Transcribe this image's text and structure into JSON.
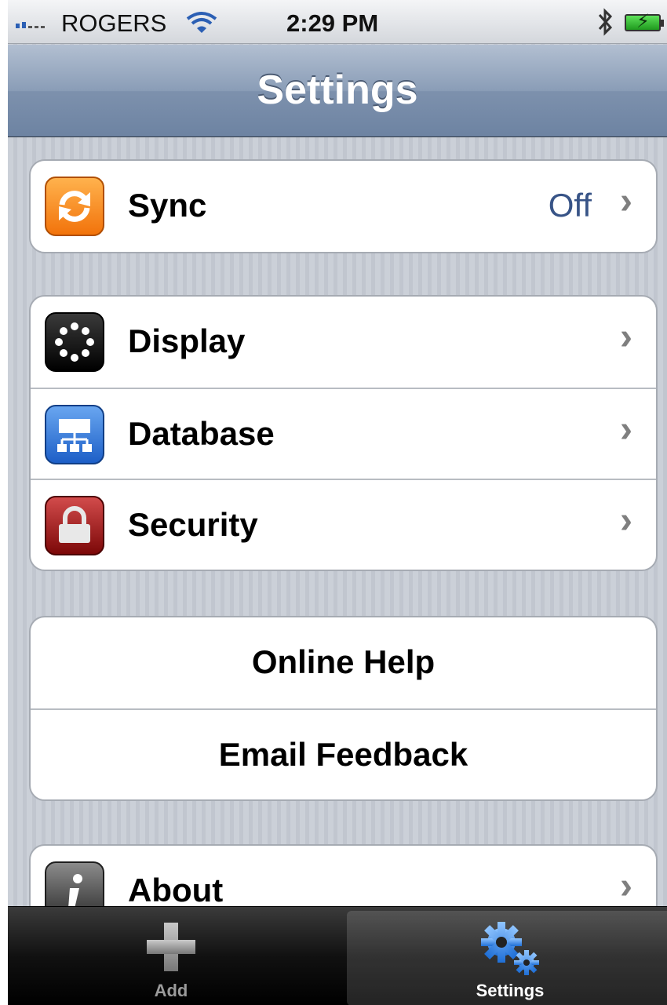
{
  "status_bar": {
    "carrier": "ROGERS",
    "time": "2:29 PM"
  },
  "nav": {
    "title": "Settings"
  },
  "groups": {
    "sync": {
      "label": "Sync",
      "value": "Off",
      "icon": "sync-icon"
    },
    "config": [
      {
        "label": "Display",
        "icon": "display-icon"
      },
      {
        "label": "Database",
        "icon": "database-icon"
      },
      {
        "label": "Security",
        "icon": "lock-icon"
      }
    ],
    "support": [
      {
        "label": "Online Help"
      },
      {
        "label": "Email Feedback"
      }
    ],
    "about": {
      "label": "About",
      "icon": "info-icon"
    }
  },
  "tab_bar": {
    "tabs": [
      {
        "label": "Add",
        "icon": "plus-icon",
        "selected": false
      },
      {
        "label": "Settings",
        "icon": "gears-icon",
        "selected": true
      }
    ]
  },
  "colors": {
    "nav_gradient_top": "#b2bfd1",
    "nav_gradient_bottom": "#6d83a2",
    "detail_value": "#385487",
    "tab_selected_icon": "#4a90e2"
  }
}
